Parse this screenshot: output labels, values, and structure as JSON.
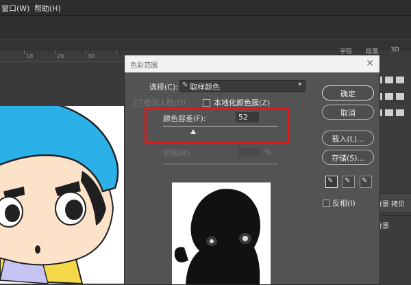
{
  "menu": {
    "window": "窗口(W)",
    "help": "帮助(H)"
  },
  "panel_tabs": {
    "tab1": "字符",
    "tab2": "段落",
    "tab3": "3D"
  },
  "ruler": {
    "labels": [
      "10",
      "20",
      "30"
    ]
  },
  "layers": {
    "bg_copy": "背景 拷贝",
    "bg": "背景"
  },
  "dialog": {
    "title": "色彩范围",
    "select_label": "选择(C):",
    "select_value": "取样颜色",
    "detect_faces": "检测人脸(D)",
    "localized_clusters": "本地化颜色簇(Z)",
    "fuzziness_label": "颜色容差(F):",
    "fuzziness_value": "52",
    "fuzziness_fraction": 0.52,
    "range_label": "范围(R):",
    "range_unit": "%",
    "ok": "确定",
    "cancel": "取消",
    "load": "载入(L)...",
    "save": "存储(S)...",
    "invert": "反相(I)"
  },
  "colors": {
    "highlight": "#e01a1a",
    "hat": "#2bb0e8",
    "shirt": "#f5d84a",
    "skin": "#fbe2c8"
  }
}
